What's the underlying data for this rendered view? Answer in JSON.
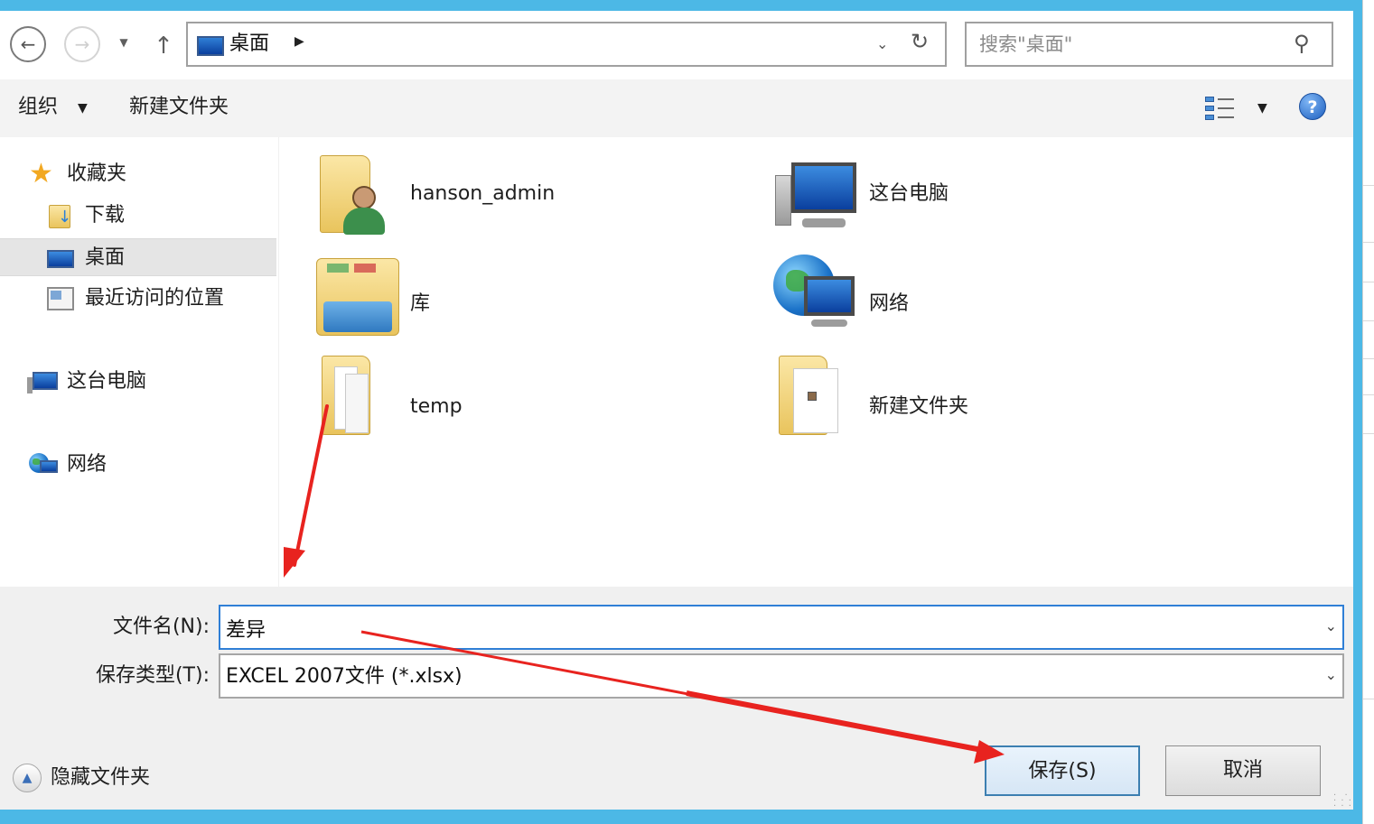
{
  "nav": {
    "back_icon": "arrow-left-icon",
    "forward_icon": "arrow-right-icon",
    "up_icon": "arrow-up-icon",
    "address": {
      "crumb": "桌面",
      "current": "桌面"
    },
    "search": {
      "placeholder": "搜索\"桌面\""
    }
  },
  "toolbar": {
    "organize_label": "组织",
    "new_folder_label": "新建文件夹",
    "view_icon": "view-options-icon",
    "help_icon": "help-icon"
  },
  "sidebar": {
    "favorites": {
      "label": "收藏夹",
      "items": [
        {
          "label": "下载",
          "icon": "downloads-folder-icon"
        },
        {
          "label": "桌面",
          "icon": "desktop-icon",
          "selected": true
        },
        {
          "label": "最近访问的位置",
          "icon": "recent-places-icon"
        }
      ]
    },
    "this_pc": {
      "label": "这台电脑",
      "icon": "computer-icon"
    },
    "network": {
      "label": "网络",
      "icon": "network-icon"
    }
  },
  "items": [
    {
      "label": "hanson_admin",
      "icon": "user-folder-icon"
    },
    {
      "label": "这台电脑",
      "icon": "computer-icon"
    },
    {
      "label": "库",
      "icon": "libraries-icon"
    },
    {
      "label": "网络",
      "icon": "network-icon"
    },
    {
      "label": "temp",
      "icon": "folder-icon"
    },
    {
      "label": "新建文件夹",
      "icon": "folder-icon"
    }
  ],
  "bottom": {
    "filename_label": "文件名(N):",
    "filename_value": "差异",
    "filetype_label": "保存类型(T):",
    "filetype_value": "EXCEL 2007文件 (*.xlsx)",
    "hide_folders_label": "隐藏文件夹",
    "save_label": "保存(S)",
    "cancel_label": "取消"
  },
  "colors": {
    "window_frame": "#4cb8e6",
    "annotation_arrow": "#e8231f",
    "selection": "#e5e5e5"
  }
}
